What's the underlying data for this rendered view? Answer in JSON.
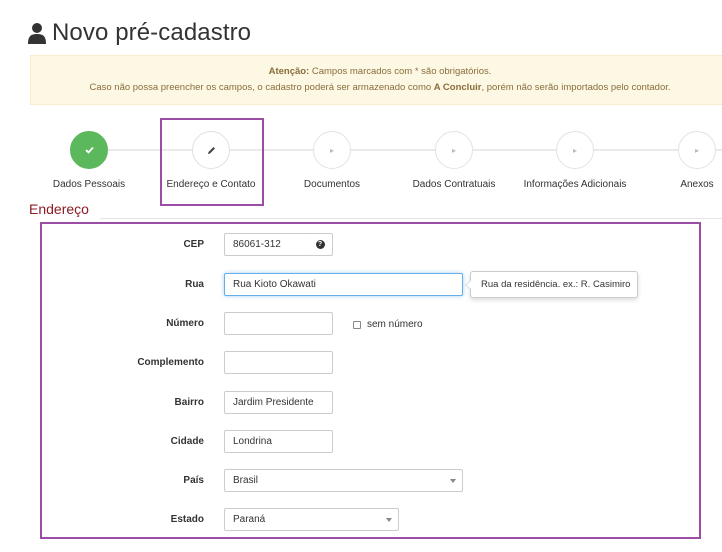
{
  "page": {
    "title": "Novo pré-cadastro",
    "title_icon": "user-icon"
  },
  "alert": {
    "line1_bold": "Atenção:",
    "line1_rest": " Campos marcados com * são obrigatórios.",
    "line2_pre": "Caso não possa preencher os campos, o cadastro poderá ser armazenado como ",
    "line2_bold": "A Concluir",
    "line2_post": ", porém não serão importados pelo contador."
  },
  "wizard": {
    "steps": [
      {
        "label": "Dados Pessoais",
        "state": "done",
        "icon": "check-icon"
      },
      {
        "label": "Endereço e Contato",
        "state": "active",
        "icon": "pencil-icon"
      },
      {
        "label": "Documentos",
        "state": "pending",
        "icon": "arrow-right-icon"
      },
      {
        "label": "Dados Contratuais",
        "state": "pending",
        "icon": "arrow-right-icon"
      },
      {
        "label": "Informações Adicionais",
        "state": "pending",
        "icon": "arrow-right-icon"
      },
      {
        "label": "Anexos",
        "state": "pending",
        "icon": "arrow-right-icon"
      }
    ]
  },
  "section": {
    "title": "Endereço"
  },
  "form": {
    "cep": {
      "label": "CEP",
      "value": "86061-312",
      "help_icon": "question-circle-icon"
    },
    "rua": {
      "label": "Rua",
      "value": "Rua Kioto Okawati",
      "tooltip": "Rua da residência. ex.: R. Casimiro"
    },
    "numero": {
      "label": "Número",
      "value": "",
      "no_number_label": "sem número",
      "no_number_checked": false
    },
    "complemento": {
      "label": "Complemento",
      "value": ""
    },
    "bairro": {
      "label": "Bairro",
      "value": "Jardim Presidente"
    },
    "cidade": {
      "label": "Cidade",
      "value": "Londrina"
    },
    "pais": {
      "label": "País",
      "value": "Brasil"
    },
    "estado": {
      "label": "Estado",
      "value": "Paraná"
    }
  },
  "colors": {
    "accent_outline": "#9b4da6",
    "done_step": "#5cb85c",
    "section_title": "#8b1c23",
    "alert_bg": "#fcf8e3"
  }
}
